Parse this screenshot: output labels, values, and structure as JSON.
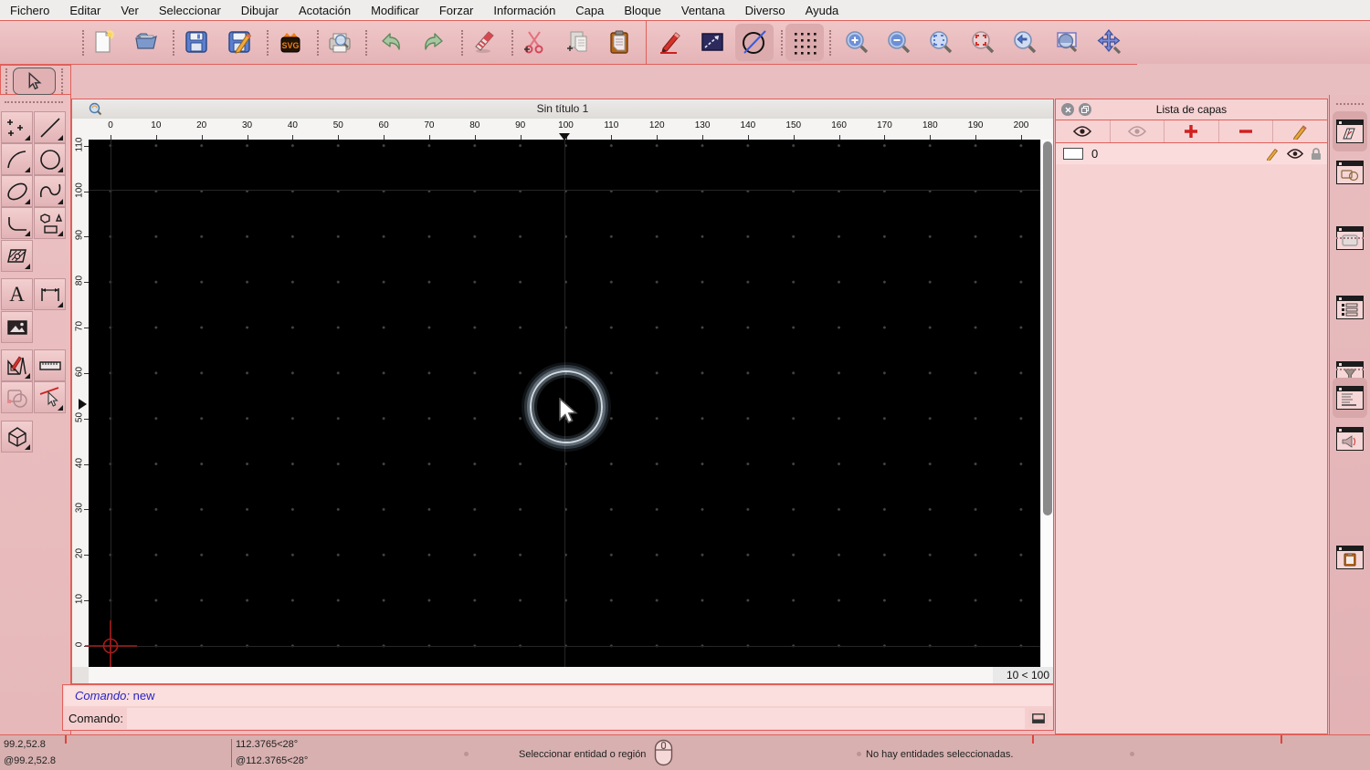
{
  "menu_bar": {
    "items": [
      "Fichero",
      "Editar",
      "Ver",
      "Seleccionar",
      "Dibujar",
      "Acotación",
      "Modificar",
      "Forzar",
      "Información",
      "Capa",
      "Bloque",
      "Ventana",
      "Diverso",
      "Ayuda"
    ]
  },
  "toolbar": {
    "svg_badge": "SVG",
    "icons": [
      "new-document",
      "open-file",
      "save",
      "save-as",
      "svg-export",
      "print-preview",
      "undo",
      "redo",
      "delete-eraser",
      "cut",
      "copy",
      "paste",
      "pen-attributes",
      "selection-window",
      "circle-line-options",
      "grid-toggle",
      "zoom-in",
      "zoom-out",
      "zoom-auto",
      "zoom-selected",
      "zoom-previous",
      "zoom-window",
      "zoom-pan"
    ],
    "select_tool": "arrow-select"
  },
  "tool_palette": {
    "text_glyph": "A",
    "icons": [
      "points",
      "line",
      "arc",
      "circle",
      "ellipse",
      "spline",
      "polyline",
      "shapes",
      "hatch",
      "text",
      "dimension",
      "image",
      "modify-tools",
      "measure",
      "modify-shapes",
      "select-entity",
      "solid-3d"
    ]
  },
  "document_window": {
    "title": "Sin título 1",
    "ruler_top_labels": [
      "0",
      "10",
      "20",
      "30",
      "40",
      "50",
      "60",
      "70",
      "80",
      "90",
      "100",
      "110",
      "120",
      "130",
      "140",
      "150",
      "160",
      "170",
      "180",
      "190",
      "200"
    ],
    "ruler_left_labels": [
      "0",
      "10",
      "20",
      "30",
      "40",
      "50",
      "60",
      "70",
      "80",
      "90",
      "100",
      "110"
    ],
    "grid_status": "10 < 100"
  },
  "layer_panel": {
    "title": "Lista de capas",
    "toolbar_icons": [
      "show-all-layers",
      "hide-all-layers",
      "add-layer",
      "remove-layer",
      "edit-layer"
    ],
    "layers": [
      {
        "name": "0",
        "icons": [
          "color-swatch",
          "edit-pencil",
          "visibility-eye",
          "lock"
        ]
      }
    ]
  },
  "right_dock": {
    "icons": [
      "layer-list-window",
      "block-list-window",
      "library-browser-window",
      "entity-list-window",
      "filter-window",
      "command-echo-window",
      "command-line-window",
      "clipboard-window"
    ]
  },
  "command_dock": {
    "history_label": "Comando:",
    "history_value": "new",
    "prompt_label": "Comando:",
    "input_value": ""
  },
  "status_bar": {
    "abs_coord": "99.2,52.8",
    "rel_coord": "@99.2,52.8",
    "abs_polar": "112.3765<28°",
    "rel_polar": "@112.3765<28°",
    "hint": "Seleccionar entidad o región",
    "selection_status": "No hay entidades seleccionadas."
  },
  "colors": {
    "chrome_pink": "#edc2c3",
    "panel_pink": "#f6d2d3",
    "accent_red_line": "#e0605a",
    "canvas_black": "#000000",
    "command_blue": "#2a24c2",
    "origin_red": "#a61b1b",
    "status_gray_pink": "#d8b0b0"
  }
}
